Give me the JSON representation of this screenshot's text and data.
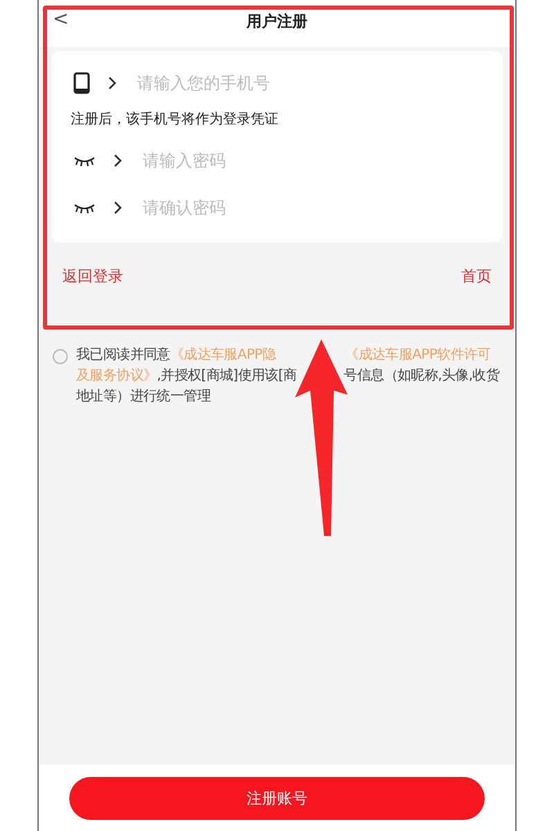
{
  "header": {
    "back": "<",
    "title": "用户注册"
  },
  "form": {
    "fields": [
      {
        "kind": "phone",
        "placeholder": "请输入您的手机号"
      },
      {
        "kind": "password",
        "placeholder": "请输入密码"
      },
      {
        "kind": "password",
        "placeholder": "请确认密码"
      }
    ],
    "hint": "注册后，该手机号将作为登录凭证"
  },
  "links": {
    "left": "返回登录",
    "right": "首页"
  },
  "agreement": {
    "checked": false,
    "lines": [
      [
        {
          "kind": "plain",
          "text": "我已阅读并同意",
          "covered_after": false
        },
        {
          "kind": "link",
          "text": "《成达车服APP隐",
          "covered_after": true
        },
        {
          "kind": "link",
          "text": "《成达车服APP软件许可",
          "covered_after": false
        }
      ],
      [
        {
          "kind": "link",
          "text": "及服务协议》",
          "covered_after": false
        },
        {
          "kind": "plain",
          "text": ",并授权[商城]使用该[商",
          "covered_after": true
        },
        {
          "kind": "plain",
          "text": "号信息（如昵称,头像,收货",
          "covered_after": false
        }
      ],
      [
        {
          "kind": "plain",
          "text": "地址等）进行统一管理",
          "covered_after": false
        }
      ]
    ]
  },
  "submit": "注册账号"
}
